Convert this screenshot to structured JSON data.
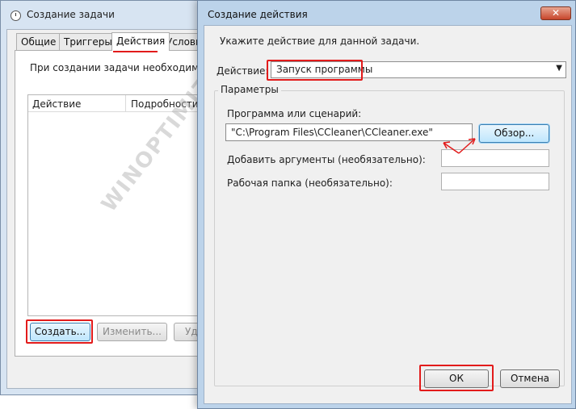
{
  "task_window": {
    "title": "Создание задачи",
    "tabs": [
      "Общие",
      "Триггеры",
      "Действия",
      "Услови"
    ],
    "active_tab": "Действия",
    "info_text": "При создании задачи необходимо ука",
    "table_headers": [
      "Действие",
      "Подробности"
    ],
    "buttons": {
      "create": "Создать...",
      "edit": "Изменить...",
      "delete": "Уд"
    }
  },
  "action_dialog": {
    "title": "Создание действия",
    "close_icon": "close-icon",
    "prompt": "Укажите действие для данной задачи.",
    "action_label": "Действие:",
    "action_value": "Запуск программы",
    "params_group": "Параметры",
    "program_label": "Программа или сценарий:",
    "program_value": "\"C:\\Program Files\\CCleaner\\CCleaner.exe\"",
    "browse_button": "Обзор...",
    "args_label": "Добавить аргументы (необязательно):",
    "args_value": "",
    "dir_label": "Рабочая папка (необязательно):",
    "dir_value": "",
    "ok_button": "ОК",
    "cancel_button": "Отмена"
  },
  "watermark": "WINOPTIMIZATOR.RU",
  "colors": {
    "highlight": "#e21b1b",
    "dialog_frame": "#bcd3ea",
    "button_focus": "#3c7fb1"
  }
}
